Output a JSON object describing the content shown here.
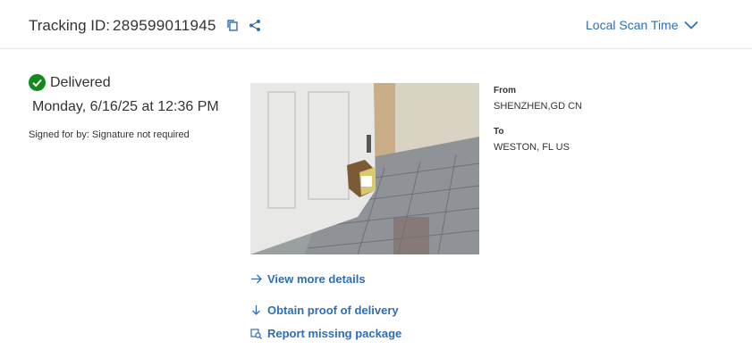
{
  "header": {
    "tracking_label": "Tracking ID:",
    "tracking_id": "289599011945",
    "copy_icon": "copy-icon",
    "share_icon": "share-icon",
    "scan_time_label": "Local Scan Time",
    "accent_color": "#2e6eb5"
  },
  "status": {
    "label": "Delivered",
    "date": "Monday, 6/16/25 at 12:36 PM",
    "signed_for": "Signed for by: Signature not required",
    "status_color": "#128a1e"
  },
  "shipment": {
    "from_label": "From",
    "from_value": "SHENZHEN,GD CN",
    "to_label": "To",
    "to_value": "WESTON, FL US"
  },
  "actions": {
    "view_details": "View more details",
    "proof_of_delivery": "Obtain proof of delivery",
    "report_missing": "Report missing package"
  }
}
